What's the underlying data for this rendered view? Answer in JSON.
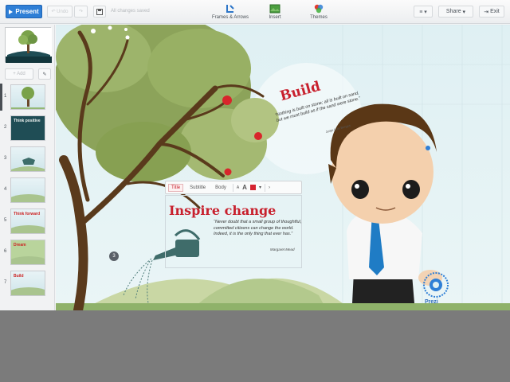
{
  "toolbar": {
    "present_label": "Present",
    "undo_label": "Undo",
    "save_status": "All changes saved",
    "frames_label": "Frames & Arrows",
    "insert_label": "Insert",
    "themes_label": "Themes",
    "menu_label": "≡ ▾",
    "share_label": "Share",
    "exit_label": "Exit"
  },
  "sidebar": {
    "add_label": "+ Add",
    "slides": [
      {
        "num": "1",
        "caption": ""
      },
      {
        "num": "2",
        "caption": "Think positive"
      },
      {
        "num": "3",
        "caption": ""
      },
      {
        "num": "4",
        "caption": ""
      },
      {
        "num": "5",
        "caption": "Think forward"
      },
      {
        "num": "6",
        "caption": "Dream"
      },
      {
        "num": "7",
        "caption": "Build"
      }
    ]
  },
  "canvas": {
    "build_title": "Build",
    "build_quote": "“Nothing is built on stone; all is built on sand, but we must build as if the sand were stone.”",
    "build_author": "Jorge Luis Borges",
    "text_toolbar": {
      "title": "Title",
      "subtitle": "Subtitle",
      "body": "Body"
    },
    "inspire_title": "Inspire change",
    "inspire_quote": "“Never doubt that a small group of thoughtful, committed citizens can change the world. Indeed, it is the only thing that ever has.”",
    "inspire_author": "Margaret Mead",
    "step_number": "3",
    "prezi_label": "Prezi"
  },
  "colors": {
    "present_blue": "#2f7fd6",
    "title_red": "#c8202d",
    "background_gray": "#7b7b7b"
  },
  "icons": [
    "play-icon",
    "undo-icon",
    "redo-icon",
    "save-icon",
    "frames-icon",
    "insert-icon",
    "themes-icon",
    "menu-icon",
    "chevron-down-icon",
    "exit-icon",
    "pencil-icon",
    "watering-can-icon",
    "prezi-logo-icon"
  ]
}
